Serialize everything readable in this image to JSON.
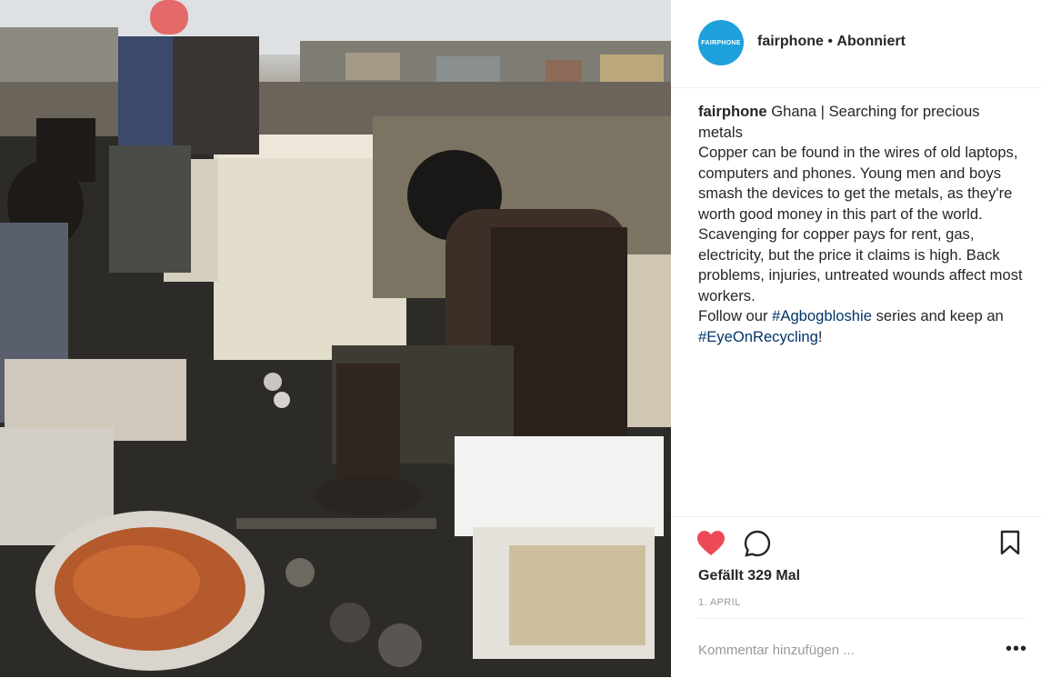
{
  "post": {
    "image_alt": "Photo of workers sorting electronic waste"
  },
  "header": {
    "avatar_text": "FAIRPHONE",
    "username": "fairphone",
    "separator": " • ",
    "follow_status": "Abonniert"
  },
  "caption": {
    "username": "fairphone",
    "line1": " Ghana | Searching for precious metals",
    "body": "Copper can be found in the wires of old laptops, computers and phones. Young men and boys smash the devices to get the metals, as they're worth good money in this part of the world. Scavenging for copper pays for rent, gas, electricity, but the price it claims is high. Back problems, injuries, untreated wounds affect most workers.",
    "follow_prefix": "Follow our ",
    "hashtag1": "#Agbogbloshie",
    "follow_middle": " series and keep an ",
    "hashtag2": "#EyeOnRecycling",
    "follow_suffix": "!"
  },
  "actions": {
    "like_icon": "heart-icon",
    "comment_icon": "comment-icon",
    "save_icon": "bookmark-icon",
    "like_color": "#ed4956"
  },
  "likes": {
    "text": "Gefällt 329 Mal"
  },
  "date": {
    "text": "1. APRIL"
  },
  "comment": {
    "placeholder": "Kommentar hinzufügen ...",
    "more_label": "•••"
  }
}
